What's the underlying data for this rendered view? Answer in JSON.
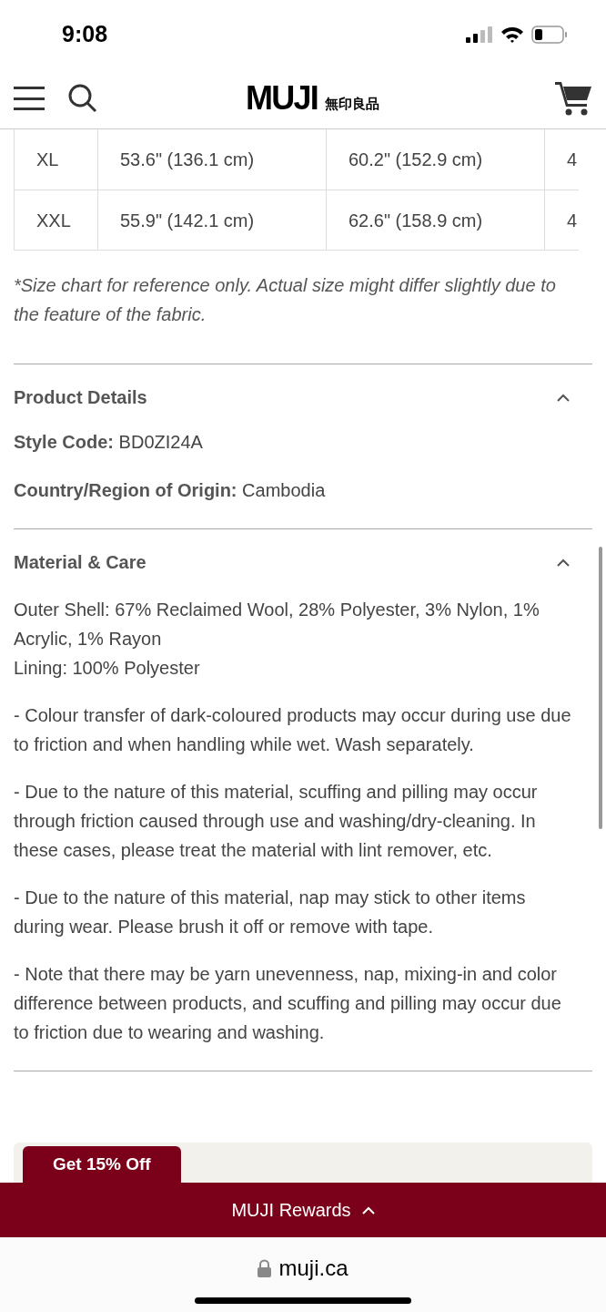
{
  "status_bar": {
    "time": "9:08"
  },
  "header": {
    "logo": "MUJI",
    "logo_jp": "無印良品"
  },
  "size_table": {
    "rows": [
      {
        "cells": [
          "XL",
          "53.6\" (136.1 cm)",
          "60.2\" (152.9 cm)",
          "4"
        ]
      },
      {
        "cells": [
          "XXL",
          "55.9\" (142.1 cm)",
          "62.6\" (158.9 cm)",
          "4"
        ]
      }
    ]
  },
  "size_note": "*Size chart for reference only. Actual size might differ slightly due to the feature of the fabric.",
  "sections": [
    {
      "title": "Product Details",
      "expanded": true,
      "lines": [
        {
          "label": "Style Code:",
          "value": "BD0ZI24A"
        },
        {
          "label": "Country/Region of Origin:",
          "value": "Cambodia"
        }
      ]
    },
    {
      "title": "Material & Care",
      "expanded": true,
      "paragraphs": [
        "Outer Shell: 67% Reclaimed Wool, 28% Polyester, 3% Nylon, 1% Acrylic, 1% Rayon\nLining: 100% Polyester",
        "- Colour transfer of dark-coloured products may occur during use due to friction and when handling while wet. Wash separately.",
        "- Due to the nature of this material, scuffing and pilling may occur through friction caused through use and washing/dry-cleaning. In these cases, please treat the material with lint remover, etc.",
        "- Due to the nature of this material, nap may stick to other items during wear. Please brush it off or remove with tape.",
        "- Note that there may be yarn unevenness, nap, mixing-in and color difference between products, and scuffing and pilling may occur due to friction due to wearing and washing."
      ]
    }
  ],
  "promo_tab": "Get 15% Off",
  "rewards_bar": {
    "label": "MUJI Rewards",
    "expanded": false
  },
  "browser": {
    "url": "muji.ca"
  }
}
